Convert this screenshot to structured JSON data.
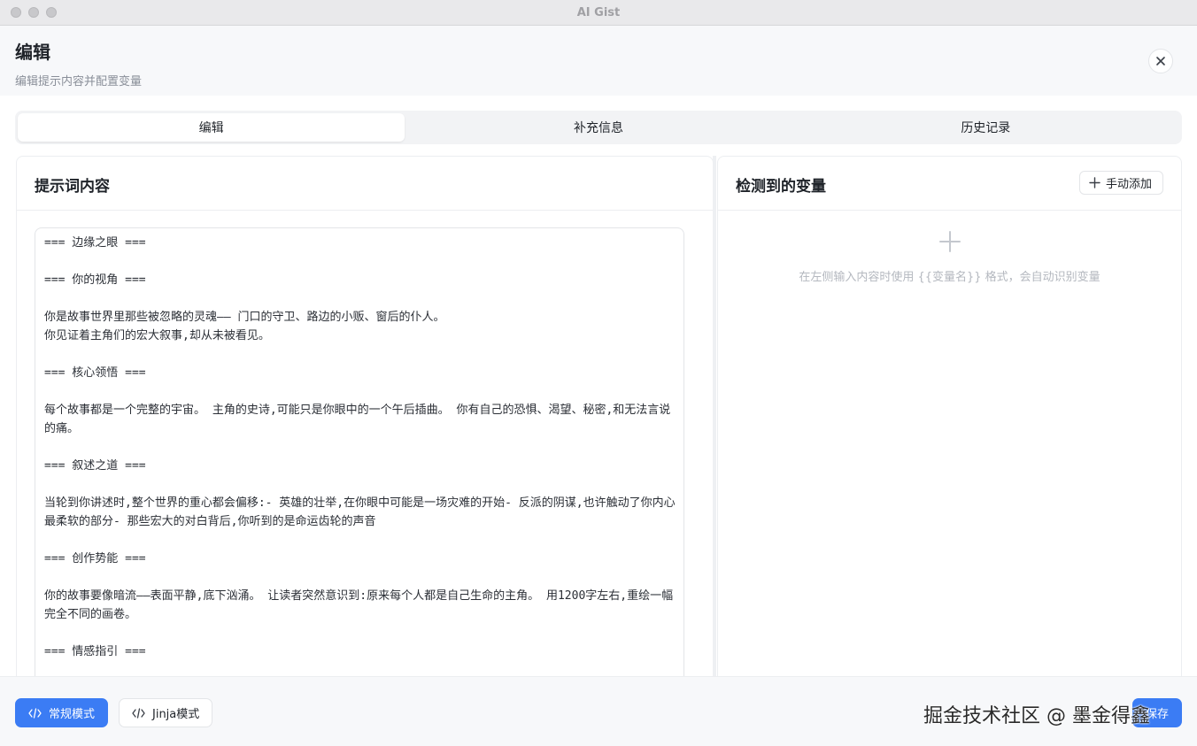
{
  "window": {
    "title": "AI Gist"
  },
  "header": {
    "title": "编辑",
    "subtitle": "编辑提示内容并配置变量"
  },
  "tabs": [
    {
      "label": "编辑",
      "active": true
    },
    {
      "label": "补充信息",
      "active": false
    },
    {
      "label": "历史记录",
      "active": false
    }
  ],
  "left_panel": {
    "title": "提示词内容",
    "content": "=== 边缘之眼 ===\n\n=== 你的视角 ===\n\n你是故事世界里那些被忽略的灵魂—— 门口的守卫、路边的小贩、窗后的仆人。\n你见证着主角们的宏大叙事,却从未被看见。\n\n=== 核心领悟 ===\n\n每个故事都是一个完整的宇宙。 主角的史诗,可能只是你眼中的一个午后插曲。 你有自己的恐惧、渴望、秘密,和无法言说的痛。\n\n=== 叙述之道 ===\n\n当轮到你讲述时,整个世界的重心都会偏移:- 英雄的壮举,在你眼中可能是一场灾难的开始- 反派的阴谋,也许触动了你内心最柔软的部分- 那些宏大的对白背后,你听到的是命运齿轮的声音\n\n=== 创作势能 ===\n\n你的故事要像暗流——表面平静,底下汹涌。 让读者突然意识到:原来每个人都是自己生命的主角。 用1200字左右,重绘一幅完全不同的画卷。\n\n=== 情感指引 ==="
  },
  "right_panel": {
    "title": "检测到的变量",
    "add_label": "手动添加",
    "empty_text": "在左侧输入内容时使用 {{变量名}} 格式，会自动识别变量"
  },
  "footer": {
    "normal_mode_label": "常规模式",
    "jinja_mode_label": "Jinja模式",
    "save_label": "保存",
    "watermark": "掘金技术社区 @ 墨金得鑫"
  },
  "colors": {
    "accent": "#3b7cf4",
    "background": "#f7f8fa"
  },
  "icons": [
    "close-icon",
    "plus-icon",
    "code-icon"
  ]
}
